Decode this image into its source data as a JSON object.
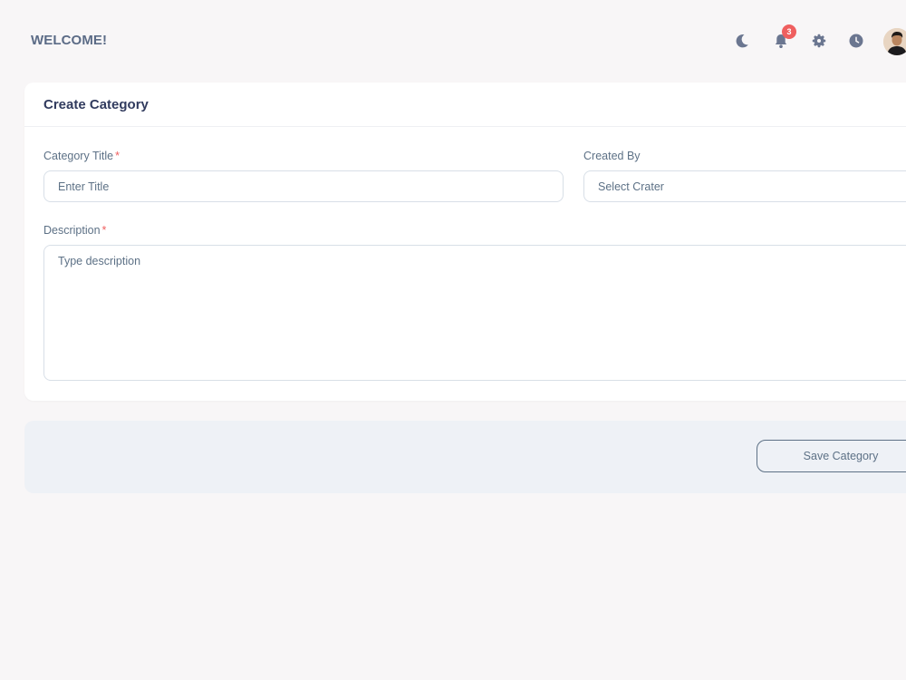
{
  "header": {
    "welcome": "WELCOME!",
    "notification_count": "3",
    "icons": [
      "moon-icon",
      "bell-icon",
      "gear-icon",
      "clock-icon",
      "avatar"
    ]
  },
  "card": {
    "title": "Create Category",
    "category_title": {
      "label": "Category Title",
      "required_mark": "*",
      "placeholder": "Enter Title"
    },
    "created_by": {
      "label": "Created By",
      "placeholder": "Select Crater"
    },
    "description": {
      "label": "Description",
      "required_mark": "*",
      "placeholder": "Type description"
    }
  },
  "footer": {
    "save_label": "Save Category"
  },
  "colors": {
    "page_bg": "#f8f6f7",
    "card_bg": "#ffffff",
    "title_text": "#313b5e",
    "body_text": "#5d7186",
    "required": "#ef5f5f",
    "footer_bg": "#eef1f6"
  }
}
